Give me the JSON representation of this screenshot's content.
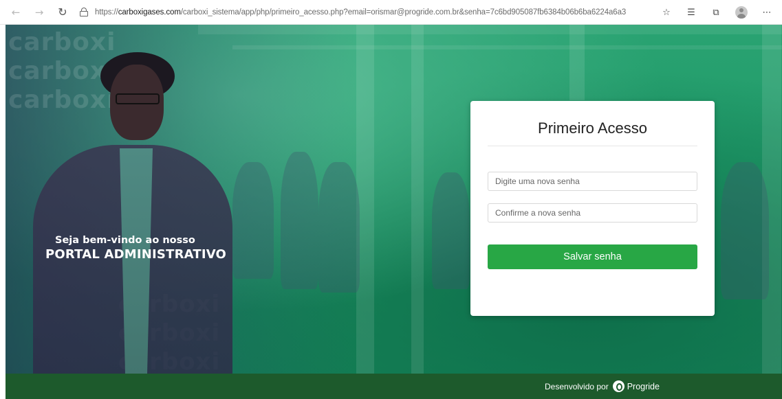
{
  "browser": {
    "url_prefix": "https://",
    "url_host": "carboxigases.com",
    "url_rest": "/carboxi_sistema/app/php/primeiro_acesso.php?email=orismar@progride.com.br&senha=7c6bd905087fb6384b06b6ba6224a6a3",
    "icons": [
      "back-icon",
      "forward-icon",
      "reload-icon",
      "lock-icon",
      "favorite-add-icon",
      "favorites-icon",
      "collections-icon",
      "profile-avatar",
      "more-icon"
    ]
  },
  "hero": {
    "welcome_line1": "Seja bem-vindo ao nosso",
    "welcome_line2": "PORTAL ADMINISTRATIVO",
    "watermark": "carboxi"
  },
  "card": {
    "title": "Primeiro Acesso",
    "new_password_placeholder": "Digite uma nova senha",
    "confirm_password_placeholder": "Confirme a nova senha",
    "save_label": "Salvar senha"
  },
  "footer": {
    "developed_by": "Desenvolvido por",
    "brand": "Progride"
  },
  "colors": {
    "accent_green": "#28a745",
    "footer_green": "#1d5a2c",
    "hero_green": "#1f9a68"
  }
}
